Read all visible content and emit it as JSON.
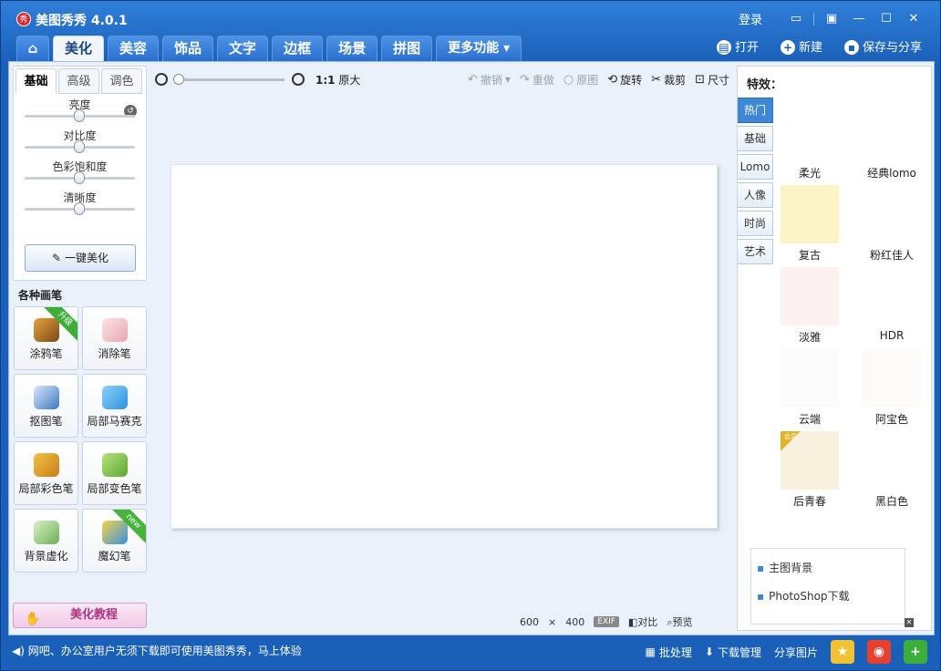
{
  "window": {
    "title": "美图秀秀 4.0.1",
    "logo_text": "秀",
    "login": "登录"
  },
  "tabs": [
    "美化",
    "美容",
    "饰品",
    "文字",
    "边框",
    "场景",
    "拼图",
    "更多功能"
  ],
  "actions": {
    "open": "打开",
    "new": "新建",
    "save_share": "保存与分享"
  },
  "left": {
    "subtabs": [
      "基础",
      "高级",
      "调色"
    ],
    "sliders": [
      {
        "label": "亮度",
        "value": 0.5
      },
      {
        "label": "对比度",
        "value": 0.5
      },
      {
        "label": "色彩饱和度",
        "value": 0.5
      },
      {
        "label": "清晰度",
        "value": 0.5
      }
    ],
    "one_key": "一键美化",
    "brush_title": "各种画笔",
    "brushes": [
      {
        "label": "涂鸦笔",
        "badge": "升级"
      },
      {
        "label": "消除笔",
        "badge": ""
      },
      {
        "label": "抠图笔",
        "badge": ""
      },
      {
        "label": "局部马赛克",
        "badge": ""
      },
      {
        "label": "局部彩色笔",
        "badge": ""
      },
      {
        "label": "局部变色笔",
        "badge": ""
      },
      {
        "label": "背景虚化",
        "badge": ""
      },
      {
        "label": "魔幻笔",
        "badge": "new"
      }
    ],
    "tutorial": "美化教程"
  },
  "toolbar": {
    "zoom_label": "原大",
    "zoom_ratio": "1:1",
    "undo": "撤销",
    "redo": "重做",
    "original": "原图",
    "rotate": "旋转",
    "crop": "裁剪",
    "size": "尺寸"
  },
  "canvas": {
    "width_text": "600",
    "times": "×",
    "height_text": "400",
    "exif": "EXIF",
    "compare": "对比",
    "preview": "预览"
  },
  "effects": {
    "header": "特效：",
    "categories": [
      "热门",
      "基础",
      "Lomo",
      "人像",
      "时尚",
      "艺术"
    ],
    "items": [
      {
        "label": "柔光",
        "color": "#ffffff"
      },
      {
        "label": "经典lomo",
        "color": "#ffffff"
      },
      {
        "label": "复古",
        "color": "#faf3c5"
      },
      {
        "label": "粉红佳人",
        "color": "#ffffff"
      },
      {
        "label": "淡雅",
        "color": "#fdf0f0"
      },
      {
        "label": "HDR",
        "color": "#ffffff"
      },
      {
        "label": "云端",
        "color": "#fbfbfb"
      },
      {
        "label": "阿宝色",
        "color": "#fdfafa"
      },
      {
        "label": "后青春",
        "color": "#faf0de",
        "vip": "会员"
      },
      {
        "label": "黑白色",
        "color": "#ffffff"
      }
    ],
    "ad_links": [
      "主图背景",
      "PhotoShop下载"
    ]
  },
  "statusbar": {
    "message": "网吧、办公室用户无须下载即可使用美图秀秀，马上体验",
    "batch": "批处理",
    "download": "下载管理",
    "share": "分享图片"
  }
}
